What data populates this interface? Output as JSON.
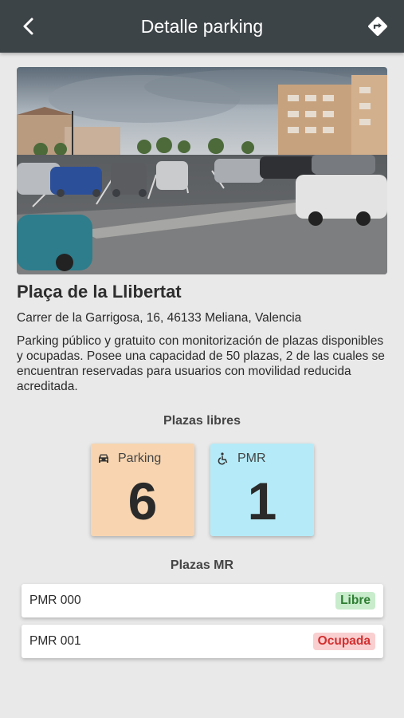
{
  "header": {
    "title": "Detalle parking",
    "back_icon": "arrow-back-icon",
    "directions_icon": "directions-icon"
  },
  "parking": {
    "name": "Plaça de la Llibertat",
    "address": "Carrer de la Garrigosa, 16, 46133 Meliana, Valencia",
    "description": "Parking público y gratuito con monitorización de plazas disponibles y ocupadas. Posee una capacidad de 50 plazas, 2 de las cuales se encuentran reservadas para usuarios con movilidad reducida acreditada."
  },
  "free_spots": {
    "title": "Plazas libres",
    "parking": {
      "label": "Parking",
      "count": "6",
      "icon": "car-icon",
      "color": "#f8d5b0"
    },
    "pmr": {
      "label": "PMR",
      "count": "1",
      "icon": "wheelchair-icon",
      "color": "#b5ebf8"
    }
  },
  "mr_spots": {
    "title": "Plazas MR",
    "items": [
      {
        "name": "PMR 000",
        "status": "Libre",
        "status_color": "#2e7d32"
      },
      {
        "name": "PMR 001",
        "status": "Ocupada",
        "status_color": "#d32f2f"
      }
    ]
  }
}
